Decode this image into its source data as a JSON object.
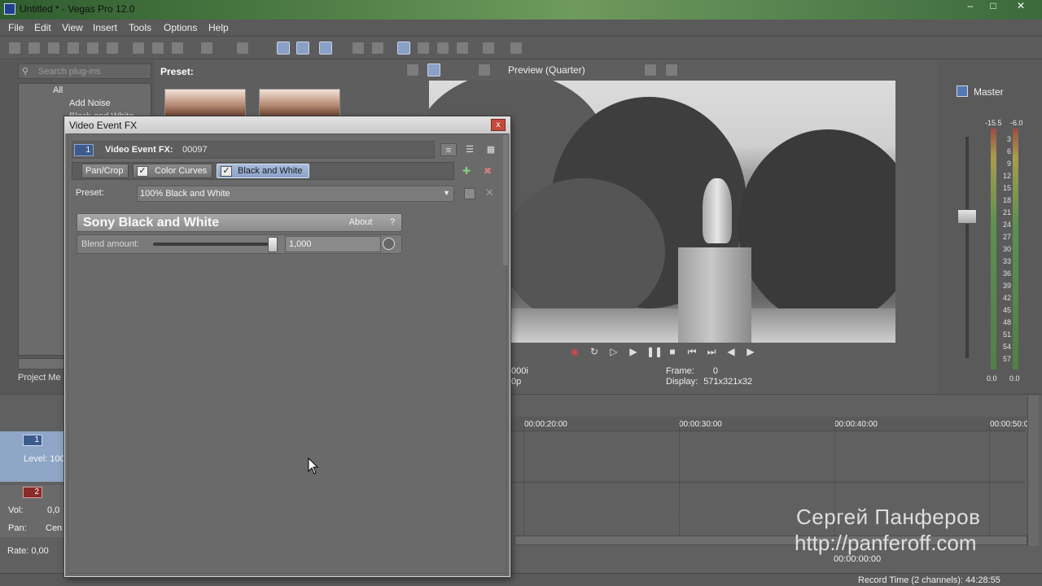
{
  "window": {
    "title": "Untitled * - Vegas Pro 12.0",
    "min": "–",
    "max": "□",
    "close": "✕"
  },
  "menu": [
    "File",
    "Edit",
    "View",
    "Insert",
    "Tools",
    "Options",
    "Help"
  ],
  "plugins": {
    "search_placeholder": "Search plug-ins",
    "tree": [
      "All",
      "Add Noise",
      "Black and White"
    ],
    "preset_label": "Preset:"
  },
  "project_media_tab": "Project Me",
  "preview": {
    "quality": "Preview (Quarter)",
    "frame_label": "Frame:",
    "frame_value": "0",
    "display_label": "Display:",
    "display_value": "571x321x32",
    "left_info_1": "000i",
    "left_info_2": "0p"
  },
  "master": {
    "label": "Master",
    "peak_l": "-15.5",
    "peak_r": "-6.0",
    "scale": [
      "3",
      "6",
      "9",
      "12",
      "15",
      "18",
      "21",
      "24",
      "27",
      "30",
      "33",
      "36",
      "39",
      "42",
      "45",
      "48",
      "51",
      "54",
      "57"
    ],
    "bottom_l": "0.0",
    "bottom_r": "0.0"
  },
  "timeline": {
    "ruler": [
      "00:00:20:00",
      "00:00:30:00",
      "00:00:40:00",
      "00:00:50:0"
    ],
    "track1": {
      "number": "1",
      "level": "Level: 100"
    },
    "track2": {
      "number": "2",
      "vol_label": "Vol:",
      "vol_value": "0,0",
      "pan_label": "Pan:",
      "pan_value": "Cen"
    },
    "rate": "Rate: 0,00",
    "timecode": "00:00:00:00",
    "record_time": "Record Time (2 channels): 44:28:55"
  },
  "watermark": {
    "name": "Сергей Панферов",
    "url": "http://panferoff.com"
  },
  "dialog": {
    "title": "Video Event FX",
    "close": "x",
    "fx_badge": "1",
    "fx_label": "Video Event FX:",
    "fx_number": "00097",
    "chain": [
      "Pan/Crop",
      "Color Curves",
      "Black and White"
    ],
    "preset_label": "Preset:",
    "preset_value": "100% Black and White",
    "plugin_name": "Sony Black and White",
    "about": "About",
    "help": "?",
    "blend_label": "Blend amount:",
    "blend_value": "1,000",
    "blend_fraction": 1.0
  },
  "colors": {
    "accent": "#8ba2c8",
    "background": "#5e5e5e",
    "record": "#c44a3d"
  }
}
